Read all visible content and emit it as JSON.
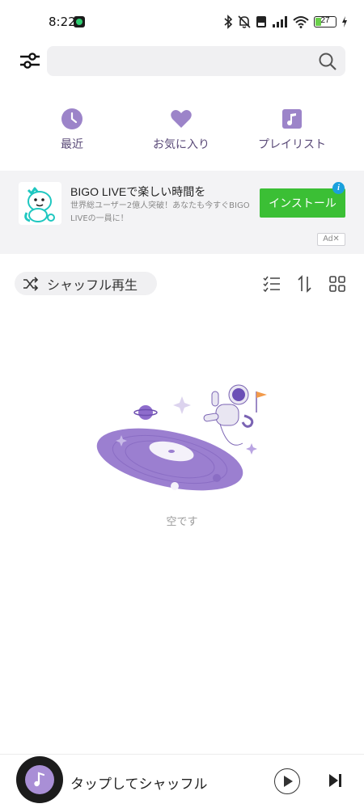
{
  "status_bar": {
    "time": "8:22",
    "battery": "27"
  },
  "header": {
    "search": {
      "value": "",
      "placeholder": ""
    }
  },
  "quick_access": [
    {
      "label": "最近",
      "icon": "clock-icon"
    },
    {
      "label": "お気に入り",
      "icon": "heart-icon"
    },
    {
      "label": "プレイリスト",
      "icon": "music-note-icon"
    }
  ],
  "ad": {
    "title": "BIGO LIVEで楽しい時間を",
    "description": "世界総ユーザー2億人突破！あなたも今すぐBIGO LIVEの一員に！",
    "install_label": "インストール",
    "info_glyph": "i",
    "badge": "Ad✕"
  },
  "toolbar": {
    "shuffle_label": "シャッフル再生"
  },
  "empty_state": {
    "text": "空です"
  },
  "player": {
    "title": "タップしてシャッフル"
  },
  "colors": {
    "accent": "#9c84c9",
    "install": "#3bbf35",
    "ad_background": "#f3f3f5"
  }
}
